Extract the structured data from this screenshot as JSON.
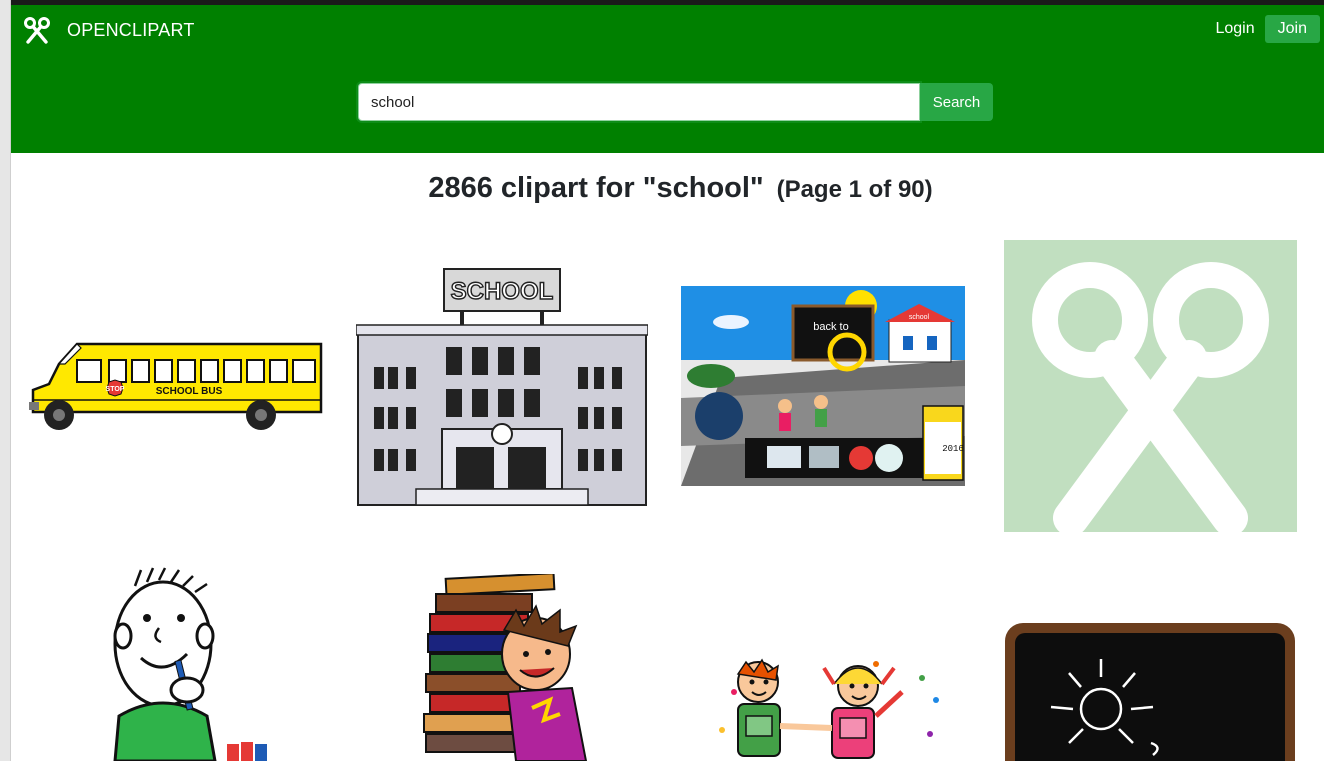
{
  "navbar": {
    "brand_icon": "scissors-icon",
    "brand_text": "OPENCLIPART",
    "login_label": "Login",
    "join_label": "Join",
    "background_color": "#008000",
    "button_color": "#28a745"
  },
  "search": {
    "value": "school",
    "button_label": "Search"
  },
  "results": {
    "count_text": "2866 clipart for \"school\"",
    "page_text": "(Page 1 of 90)"
  },
  "clipart": [
    {
      "name": "school-bus-clipart",
      "label": "SCHOOL BUS",
      "stop_sign": "STOP"
    },
    {
      "name": "school-building-clipart",
      "label": "SCHOOL"
    },
    {
      "name": "back-to-school-collage-clipart",
      "label_line1": "back to",
      "label_line2": "school",
      "year": "2016"
    },
    {
      "name": "scissors-placeholder-clipart"
    },
    {
      "name": "boy-thinking-clipart"
    },
    {
      "name": "boy-carrying-books-clipart"
    },
    {
      "name": "kids-with-backpacks-clipart"
    },
    {
      "name": "chalkboard-sun-clipart"
    }
  ]
}
